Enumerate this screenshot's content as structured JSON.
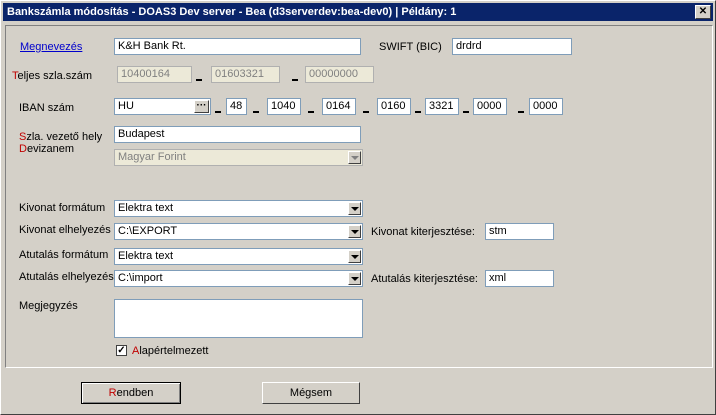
{
  "window": {
    "title": "Bankszámla módosítás - DOAS3 Dev server - Bea (d3serverdev:bea-dev0) | Példány: 1",
    "close": "✕"
  },
  "fields": {
    "megnevezes": {
      "label": "Megnevezés",
      "value": "K&H Bank Rt."
    },
    "swift": {
      "label": "SWIFT (BIC)",
      "value": "drdrd"
    },
    "teljes": {
      "label_first": "T",
      "label_rest": "eljes szla.szám",
      "parts": [
        "10400164",
        "01603321",
        "00000000"
      ]
    },
    "iban": {
      "label": "IBAN szám",
      "country": "HU",
      "ellipsis": "···",
      "parts": [
        "48",
        "1040",
        "0164",
        "0160",
        "3321",
        "0000",
        "0000"
      ]
    },
    "vezeto": {
      "label_first": "S",
      "label_rest": "zla. vezető hely",
      "value": "Budapest"
    },
    "deviza": {
      "label_first": "D",
      "label_rest": "evizanem",
      "value": "Magyar Forint"
    },
    "kivonat_format": {
      "label": "Kivonat formátum",
      "value": "Elektra text"
    },
    "kivonat_elh": {
      "label": "Kivonat elhelyezés",
      "value": "C:\\EXPORT"
    },
    "kivonat_kit": {
      "label": "Kivonat kiterjesztése:",
      "value": "stm"
    },
    "atutalas_format": {
      "label": "Atutalás formátum",
      "value": "Elektra text"
    },
    "atutalas_elh": {
      "label": "Atutalás elhelyezés",
      "value": "C:\\import"
    },
    "atutalas_kit": {
      "label": "Atutalás kiterjesztése:",
      "value": "xml"
    },
    "megjegyzes": {
      "label": "Megjegyzés",
      "value": ""
    },
    "alap": {
      "label_first": "A",
      "label_rest": "lapértelmezett",
      "checked": "✓"
    }
  },
  "buttons": {
    "ok": {
      "first": "R",
      "rest": "endben"
    },
    "cancel": "Mégsem"
  }
}
